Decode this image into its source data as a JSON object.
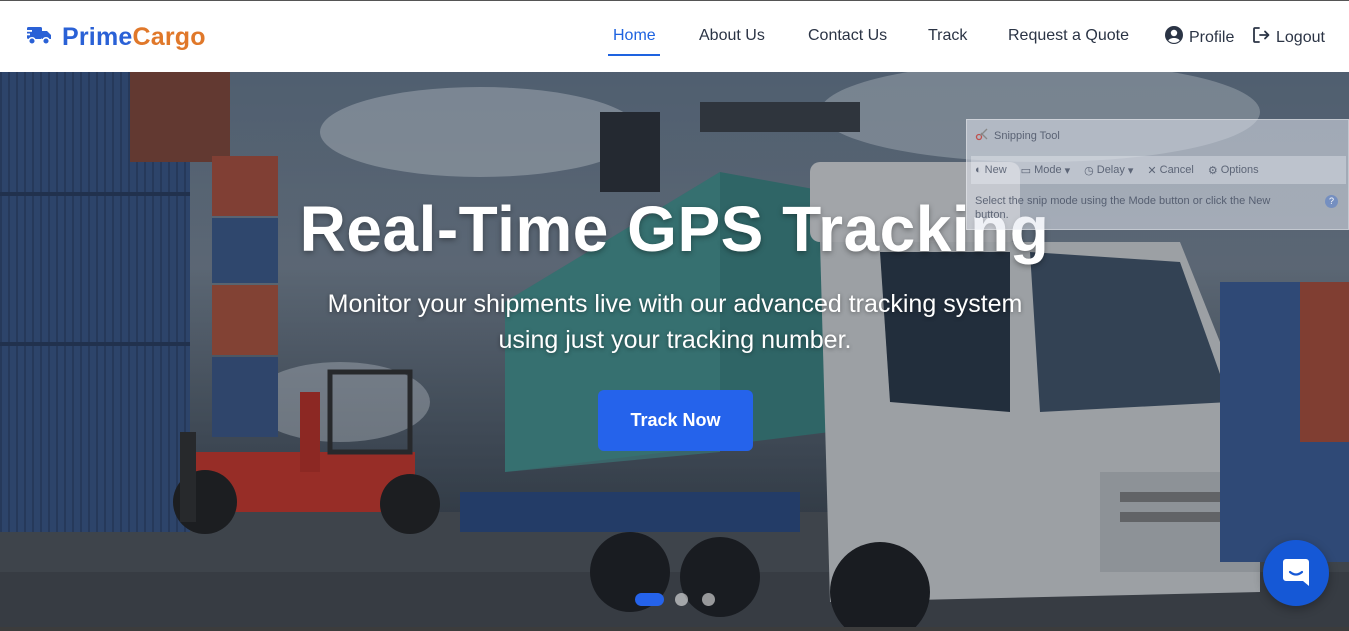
{
  "brand": {
    "name_part1": "Prime",
    "name_part2": "Cargo",
    "icon": "truck-icon"
  },
  "nav": {
    "items": [
      {
        "label": "Home",
        "active": true
      },
      {
        "label": "About Us"
      },
      {
        "label": "Contact Us"
      },
      {
        "label": "Track"
      },
      {
        "label": "Request a Quote"
      }
    ],
    "profile": {
      "label": "Profile",
      "icon": "user-circle-icon"
    },
    "logout": {
      "label": "Logout",
      "icon": "logout-icon"
    }
  },
  "hero": {
    "title": "Real-Time GPS Tracking",
    "subtitle_line1": "Monitor your shipments live with our advanced tracking system",
    "subtitle_line2": "using just your tracking number.",
    "cta_label": "Track Now",
    "carousel": {
      "slide_count": 3,
      "active_index": 0
    }
  },
  "snipping_tool": {
    "title": "Snipping Tool",
    "toolbar": {
      "new": "New",
      "mode": "Mode",
      "delay": "Delay",
      "cancel": "Cancel",
      "options": "Options"
    },
    "help_text": "Select the snip mode using the Mode button or click the New button."
  },
  "chat_widget": {
    "icon": "chat-bubble-icon"
  },
  "colors": {
    "accent": "#2563eb",
    "brand_blue": "#2a61d6",
    "brand_orange": "#e0782a",
    "nav_text": "#2b3445"
  }
}
